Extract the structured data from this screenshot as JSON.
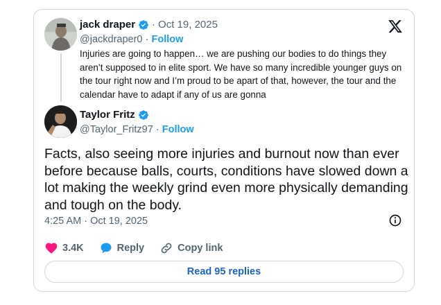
{
  "quoted": {
    "name": "jack draper",
    "date": "Oct 19, 2025",
    "handle": "@jackdraper0",
    "follow": "Follow",
    "text": "Injuries are going to happen… we are pushing our bodies to do things they aren’t supposed to in elite sport. We have so many incredible younger guys on the tour right now and I’m proud to be apart of that, however, the tour and the calendar have to adapt if any of us are gonna"
  },
  "main": {
    "name": "Taylor Fritz",
    "handle": "@Taylor_Fritz97",
    "follow": "Follow",
    "text": "Facts, also seeing more injuries and burnout now than ever before because balls, courts, conditions have slowed down a lot making the weekly grind even more physically demanding and tough on the body.",
    "timestamp": "4:25 AM · Oct 19, 2025"
  },
  "separator": "·",
  "actions": {
    "like_count": "3.4K",
    "reply_label": "Reply",
    "copy_label": "Copy link"
  },
  "read_replies": "Read 95 replies",
  "colors": {
    "accent": "#1d9bf0",
    "like": "#f91880",
    "text": "#0f1419",
    "muted": "#536471",
    "border": "#cfd9de"
  },
  "icons": [
    "x-logo-icon",
    "verified-badge-icon",
    "info-icon",
    "heart-icon",
    "reply-bubble-icon",
    "link-icon"
  ]
}
